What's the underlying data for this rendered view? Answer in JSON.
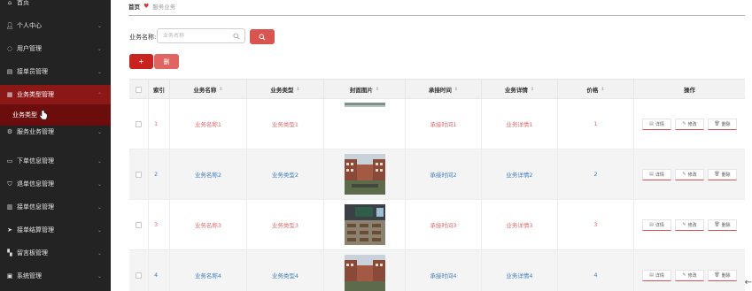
{
  "sidebar": {
    "items": [
      {
        "icon": "home-icon",
        "label": "首页"
      },
      {
        "icon": "user-icon",
        "label": "个人中心"
      },
      {
        "icon": "users-icon",
        "label": "用户管理"
      },
      {
        "icon": "clipboard-icon",
        "label": "接单员管理"
      },
      {
        "icon": "grid-icon",
        "label": "业务类型管理"
      },
      {
        "icon": "gear-icon",
        "label": "服务业务管理"
      },
      {
        "icon": "file-icon",
        "label": "下单信息管理"
      },
      {
        "icon": "shield-icon",
        "label": "退单信息管理"
      },
      {
        "icon": "order-icon",
        "label": "接单信息管理"
      },
      {
        "icon": "send-icon",
        "label": "接单结算管理"
      },
      {
        "icon": "board-icon",
        "label": "留言板管理"
      },
      {
        "icon": "system-icon",
        "label": "系统管理"
      }
    ],
    "submenu_label": "业务类型"
  },
  "breadcrumb": {
    "home": "首页",
    "current": "服务业务"
  },
  "search": {
    "label": "业务名称:",
    "placeholder": "业务名称"
  },
  "toolbar": {
    "add_label": "+",
    "delete_label": "删"
  },
  "table": {
    "headers": {
      "index": "索引",
      "name": "业务名称",
      "type": "业务类型",
      "cover": "封面图片",
      "time": "承接时间",
      "detail": "业务详情",
      "price": "价格",
      "ops": "操作"
    },
    "rows": [
      {
        "index": "1",
        "name": "业务名称1",
        "type": "业务类型1",
        "time": "承接时间1",
        "detail": "业务详情1",
        "price": "1"
      },
      {
        "index": "2",
        "name": "业务名称2",
        "type": "业务类型2",
        "time": "承接时间2",
        "detail": "业务详情2",
        "price": "2"
      },
      {
        "index": "3",
        "name": "业务名称3",
        "type": "业务类型3",
        "time": "承接时间3",
        "detail": "业务详情3",
        "price": "3"
      },
      {
        "index": "4",
        "name": "业务名称4",
        "type": "业务类型4",
        "time": "承接时间4",
        "detail": "业务详情4",
        "price": "4"
      }
    ],
    "actions": {
      "detail": "详情",
      "edit": "修改",
      "delete": "删除"
    }
  },
  "colors": {
    "sidebar_bg": "#232323",
    "active_menu": "#8b1717",
    "accent": "#d9534f",
    "odd_text": "#e06b6b",
    "even_text": "#3e7dbf"
  }
}
